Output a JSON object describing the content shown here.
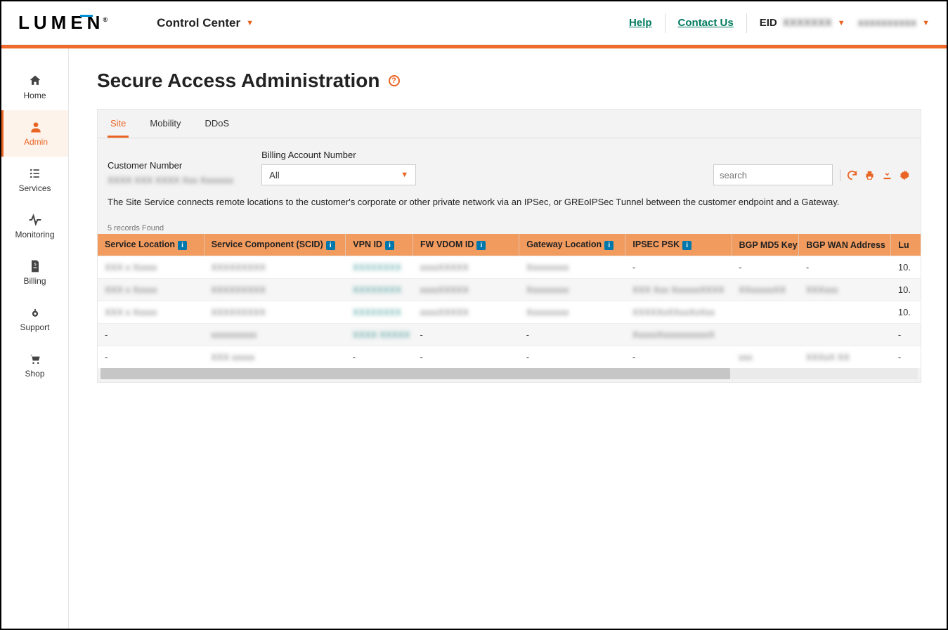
{
  "header": {
    "logo_text": "LUMEN",
    "app_switcher": "Control Center",
    "help_link": "Help",
    "contact_link": "Contact Us",
    "eid_label": "EID",
    "eid_value": "XXXXXXX",
    "account_value": "xxxxxxxxxx"
  },
  "sidebar": {
    "items": [
      {
        "label": "Home",
        "icon": "home"
      },
      {
        "label": "Admin",
        "icon": "user"
      },
      {
        "label": "Services",
        "icon": "list"
      },
      {
        "label": "Monitoring",
        "icon": "activity"
      },
      {
        "label": "Billing",
        "icon": "file"
      },
      {
        "label": "Support",
        "icon": "gear"
      },
      {
        "label": "Shop",
        "icon": "cart"
      }
    ],
    "active_index": 1
  },
  "page": {
    "title": "Secure Access Administration"
  },
  "panel": {
    "tabs": [
      "Site",
      "Mobility",
      "DDoS"
    ],
    "active_tab": 0,
    "customer_number_label": "Customer Number",
    "customer_number_value": "XXXX XXX XXXX Xxx Xxxxxxx",
    "billing_label": "Billing Account Number",
    "billing_selected": "All",
    "search_placeholder": "search",
    "description": "The Site Service connects remote locations to the customer's corporate or other private network via an IPSec, or GREoIPSec Tunnel between the customer endpoint and a Gateway.",
    "records_found": "5 records Found"
  },
  "table": {
    "columns": [
      {
        "label": "Service Location",
        "info": true
      },
      {
        "label": "Service Component (SCID)",
        "info": true
      },
      {
        "label": "VPN ID",
        "info": true
      },
      {
        "label": "FW VDOM ID",
        "info": true
      },
      {
        "label": "Gateway Location",
        "info": true
      },
      {
        "label": "IPSEC PSK",
        "info": true
      },
      {
        "label": "BGP MD5 Key",
        "info": false
      },
      {
        "label": "BGP WAN Address",
        "info": false
      },
      {
        "label": "Lu",
        "info": false
      }
    ],
    "rows": [
      {
        "sl": "XXX x Xxxxx",
        "sc": "XXXXXXXXX",
        "vpn": "XXXXXXXX",
        "fw": "xxxxXXXXX",
        "gw": "Xxxxxxxxx",
        "psk": "-",
        "md5": "-",
        "wan": "-",
        "lun": "10."
      },
      {
        "sl": "XXX x Xxxxx",
        "sc": "XXXXXXXXX",
        "vpn": "XXXXXXXX",
        "fw": "xxxxXXXXX",
        "gw": "Xxxxxxxxx",
        "psk": "XXX Xxx XxxxxxXXXX",
        "md5": "XXxxxxxXX",
        "wan": "XXXxxx",
        "lun": "10."
      },
      {
        "sl": "XXX x Xxxxx",
        "sc": "XXXXXXXXX",
        "vpn": "XXXXXXXX",
        "fw": "xxxxXXXXX",
        "gw": "Xxxxxxxxx",
        "psk": "XXXXXxXXxxXxXxx",
        "md5": "",
        "wan": "",
        "lun": "10."
      },
      {
        "sl": "-",
        "sc": "xxxxxxxxxx",
        "vpn": "XXXX XXXXX",
        "fw": "-",
        "gw": "-",
        "psk": "XxxxxXxxxxxxxxxxX",
        "md5": "",
        "wan": "",
        "lun": "-"
      },
      {
        "sl": "-",
        "sc": "XXX xxxxx",
        "vpn": "-",
        "fw": "-",
        "gw": "-",
        "psk": "-",
        "md5": "xxx",
        "wan": "XXXxX XX",
        "lun": "-"
      }
    ]
  }
}
